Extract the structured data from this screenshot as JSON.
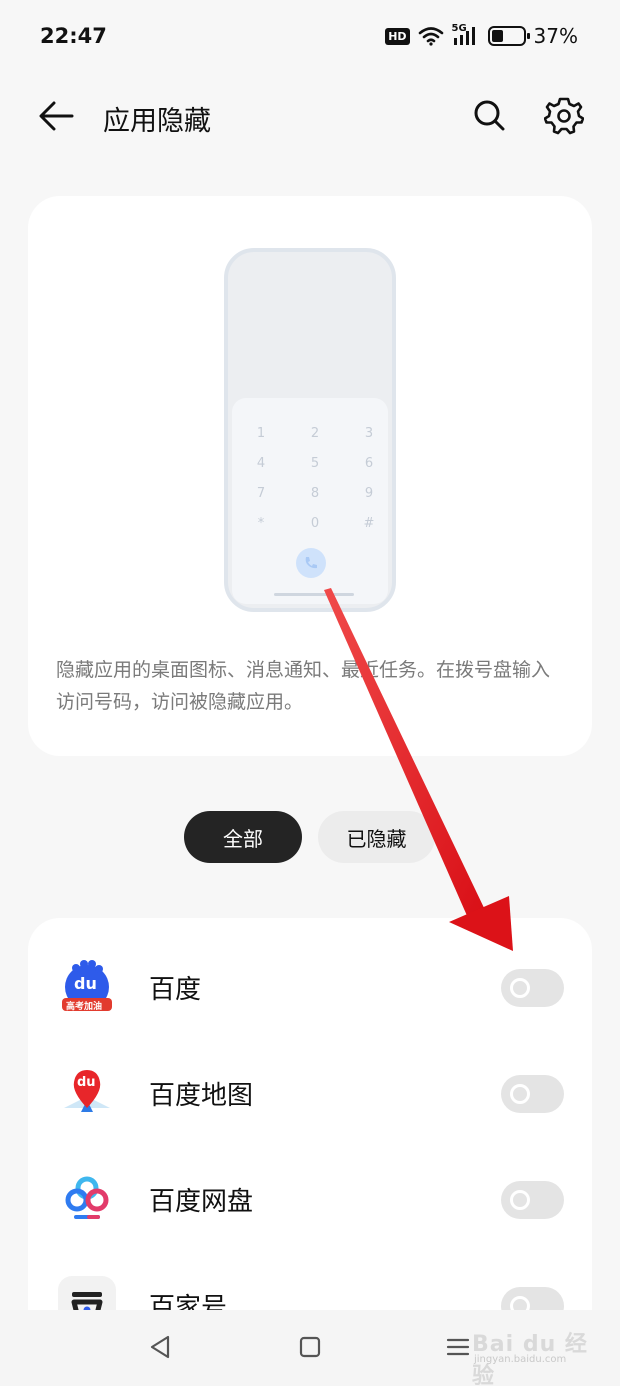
{
  "status_bar": {
    "time": "22:47",
    "hd_badge": "HD",
    "network": "5G",
    "battery_percent_text": "37%",
    "battery_level": 0.37,
    "icons": [
      "hd-icon",
      "wifi-icon",
      "signal-5g-icon",
      "battery-icon"
    ]
  },
  "header": {
    "title": "应用隐藏",
    "back_icon": "arrow-left-icon",
    "search_icon": "search-icon",
    "settings_icon": "gear-icon"
  },
  "intro": {
    "illustration": "phone-dialpad-illustration",
    "dialpad_keys": [
      "1",
      "2",
      "3",
      "4",
      "5",
      "6",
      "7",
      "8",
      "9",
      "*",
      "0",
      "#"
    ],
    "call_icon": "phone-call-icon",
    "description": "隐藏应用的桌面图标、消息通知、最近任务。在拨号盘输入访问号码，访问被隐藏应用。"
  },
  "tabs": {
    "items": [
      {
        "label": "全部",
        "selected": true
      },
      {
        "label": "已隐藏",
        "selected": false
      }
    ]
  },
  "apps": [
    {
      "name": "百度",
      "icon": "baidu-app-icon",
      "icon_badge_text": "du",
      "icon_ribbon_text": "高考加油",
      "hidden": false
    },
    {
      "name": "百度地图",
      "icon": "baidu-maps-icon",
      "icon_badge_text": "du",
      "hidden": false
    },
    {
      "name": "百度网盘",
      "icon": "baidu-netdisk-icon",
      "hidden": false
    },
    {
      "name": "百家号",
      "icon": "baijiahao-icon",
      "hidden": false
    }
  ],
  "nav_bar": {
    "back_icon": "nav-back-triangle-icon",
    "home_icon": "nav-home-square-icon",
    "menu_icon": "nav-menu-icon"
  },
  "watermark": {
    "logo_text": "Bai du 经验",
    "url_text": "jingyan.baidu.com"
  },
  "colors": {
    "background": "#f7f7f7",
    "card": "#ffffff",
    "selected_tab": "#242424",
    "unselected_tab": "#ececec",
    "toggle_off": "#e4e4e4",
    "annotation_arrow": "#e8161b"
  }
}
